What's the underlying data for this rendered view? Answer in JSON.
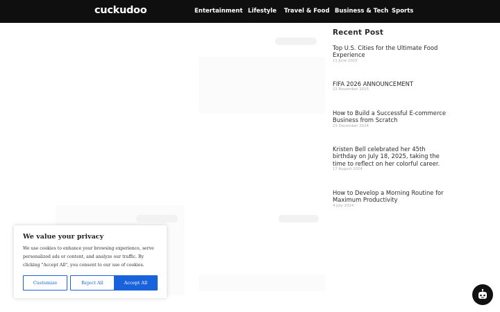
{
  "header": {
    "logo": "cuckudoo",
    "nav": [
      "Entertainment",
      "Lifestyle",
      "Travel & Food",
      "Business & Tech",
      "Sports"
    ]
  },
  "sidebar": {
    "title": "Recent Post",
    "posts": [
      {
        "title": "Top U.S. Cities for the Ultimate Food Experience",
        "date": "11 June 2025"
      },
      {
        "title": "FIFA 2026 ANNOUNCEMENT",
        "date": "21 November 2025"
      },
      {
        "title": "How to Build a Successful E-commerce Business from Scratch",
        "date": "23 December 2024"
      },
      {
        "title": "Kristen Bell celebrated her 45th birthday on July 18, 2025, taking the time to reflect on her colorful career.",
        "date": "17 August 2024"
      },
      {
        "title": "How to Develop a Morning Routine for Maximum Productivity",
        "date": "4 July 2024"
      }
    ]
  },
  "cookie": {
    "title": "We value your privacy",
    "text": "We use cookies to enhance your browsing experience, serve personalized ads or content, and analyze our traffic. By clicking \"Accept All\", you consent to our use of cookies.",
    "customize": "Customize",
    "reject": "Reject All",
    "accept": "Accept All",
    "accent": "#1863dc"
  },
  "fab": {
    "icon": "chat-bot-icon"
  }
}
